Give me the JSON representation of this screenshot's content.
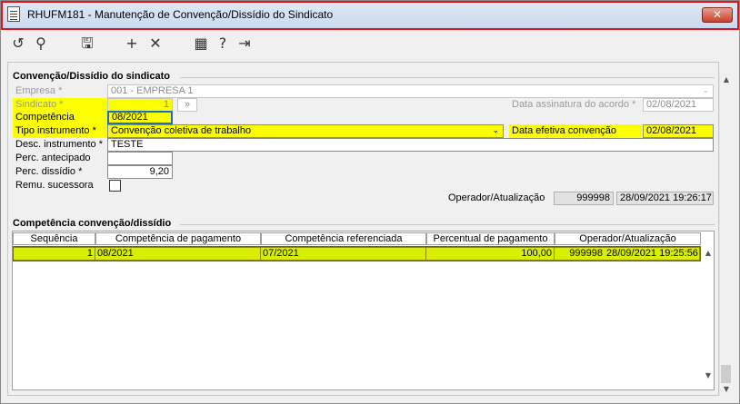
{
  "window": {
    "title": "RHUFM181 - Manutenção de Convenção/Dissídio do Sindicato",
    "close_glyph": "✕"
  },
  "toolbar": [
    {
      "icon": "refresh-icon",
      "glyph": "↺"
    },
    {
      "icon": "search-icon",
      "glyph": "⚲"
    },
    {
      "icon": "save-icon",
      "glyph": "🖫"
    },
    {
      "icon": "add-icon",
      "glyph": "+"
    },
    {
      "icon": "delete-icon",
      "glyph": "✕"
    },
    {
      "icon": "calendar-icon",
      "glyph": "▦"
    },
    {
      "icon": "help-icon",
      "glyph": "?"
    },
    {
      "icon": "exit-icon",
      "glyph": "⇥"
    }
  ],
  "section1": {
    "title": "Convenção/Dissídio do sindicato",
    "empresa_label": "Empresa *",
    "empresa_value": "001 - EMPRESA 1",
    "sindicato_label": "Sindicato *",
    "sindicato_value": "1",
    "sindicato_lookup": "»",
    "data_assinatura_label": "Data assinatura do acordo *",
    "data_assinatura_value": "02/08/2021",
    "competencia_label": "Competência",
    "competencia_value": "08/2021",
    "tipo_label": "Tipo instrumento *",
    "tipo_value": "Convenção coletiva de trabalho",
    "data_efetiva_label": "Data efetiva convenção",
    "data_efetiva_value": "02/08/2021",
    "desc_label": "Desc. instrumento *",
    "desc_value": "TESTE",
    "perc_antecipado_label": "Perc. antecipado",
    "perc_antecipado_value": "",
    "perc_dissidio_label": "Perc. dissídio *",
    "perc_dissidio_value": "9,20",
    "remu_label": "Remu. sucessora",
    "operador_label": "Operador/Atualização",
    "operador_value": "999998",
    "atualizacao_value": "28/09/2021 19:26:17"
  },
  "section2": {
    "title": "Competência convenção/dissídio",
    "columns": [
      "Sequência",
      "Competência de pagamento",
      "Competência referenciada",
      "Percentual de pagamento",
      "Operador/Atualização"
    ],
    "rows": [
      {
        "seq": "1",
        "comp_pag": "08/2021",
        "comp_ref": "07/2021",
        "perc": "100,00",
        "operador": "999998",
        "atualizacao": "28/09/2021 19:25:56"
      }
    ]
  }
}
